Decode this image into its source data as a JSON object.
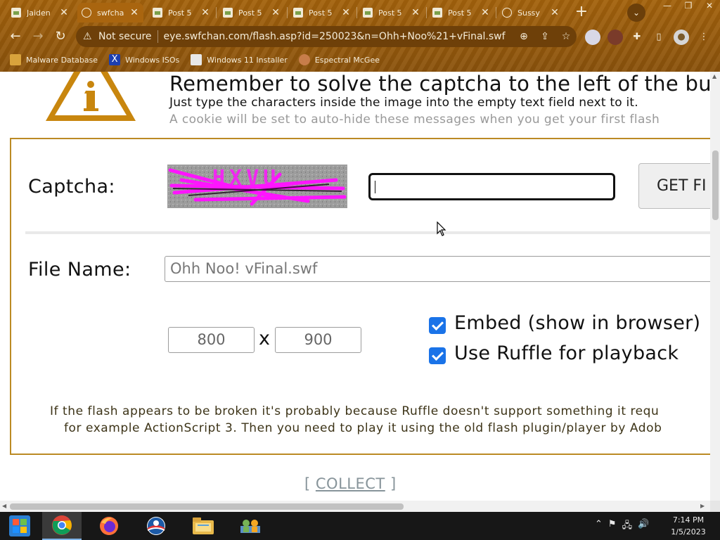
{
  "browser": {
    "tabs": [
      {
        "title": "Jaiden",
        "icon": "image-favicon-icon"
      },
      {
        "title": "swfcha",
        "icon": "globe-icon"
      },
      {
        "title": "Post 5",
        "icon": "image-favicon-icon"
      },
      {
        "title": "Post 5",
        "icon": "image-favicon-icon"
      },
      {
        "title": "Post 5",
        "icon": "image-favicon-icon"
      },
      {
        "title": "Post 5",
        "icon": "image-favicon-icon"
      },
      {
        "title": "Post 5",
        "icon": "image-favicon-icon"
      },
      {
        "title": "Sussy",
        "icon": "globe-icon"
      }
    ],
    "active_tab_index": 1,
    "security_label": "Not secure",
    "url": "eye.swfchan.com/flash.asp?id=250023&n=Ohh+Noo%21+vFinal.swf",
    "bookmarks": [
      "Malware Database",
      "Windows ISOs",
      "Windows 11 Installer",
      "Espectral McGee"
    ]
  },
  "notice": {
    "title": "Remember to solve the captcha to the left of the butto",
    "line1": "Just type the characters inside the image into the empty text field next to it.",
    "line2": "A cookie will be set to auto-hide these messages when you get your first flash"
  },
  "form": {
    "captcha_label": "Captcha:",
    "captcha_text": "HXVU",
    "captcha_value": "",
    "get_button_label": "GET FI",
    "file_name_label": "File Name:",
    "file_name_value": "Ohh Noo! vFinal.swf",
    "width_value": "800",
    "dim_separator": "x",
    "height_value": "900",
    "embed_label": "Embed (show in browser)",
    "embed_checked": true,
    "ruffle_label": "Use Ruffle for playback",
    "ruffle_checked": true,
    "info_line1": "If the flash appears to be broken it's probably because Ruffle doesn't support something it requ",
    "info_line2": "for example ActionScript 3. Then you need to play it using the old flash plugin/player by Adob"
  },
  "collect": {
    "open_bracket": "[",
    "label": "COLLECT",
    "close_bracket": "]"
  },
  "taskbar": {
    "apps": [
      "windows-start-icon",
      "chrome-icon",
      "firefox-icon",
      "obama-logo-icon",
      "file-explorer-icon",
      "network-people-icon"
    ],
    "time": "7:14 PM",
    "date": "1/5/2023"
  },
  "colors": {
    "chrome_brown": "#a3620c",
    "form_border": "#bb8a24",
    "checkbox_blue": "#1a73e8",
    "warning_orange": "#c8860e",
    "captcha_magenta": "#ff14ff"
  }
}
